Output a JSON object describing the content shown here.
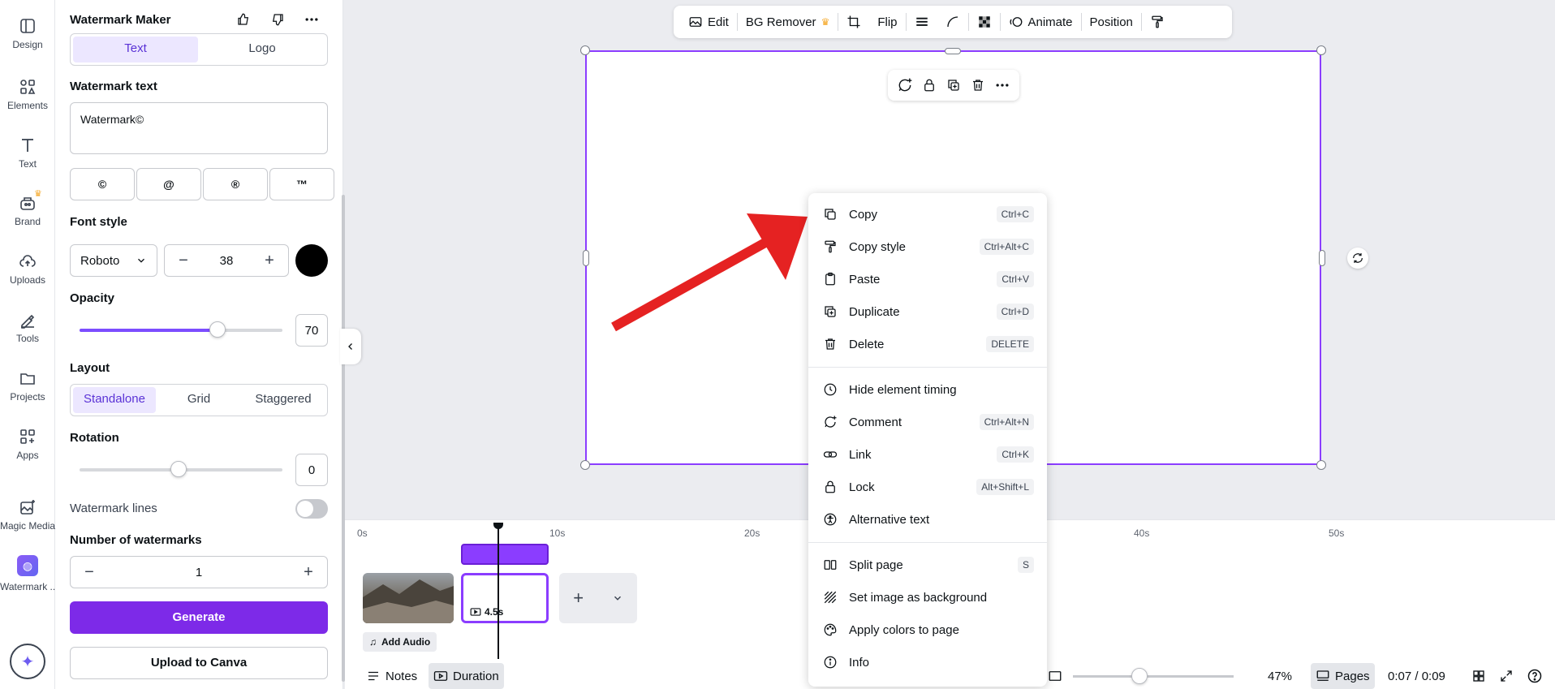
{
  "rail": {
    "items": [
      {
        "label": "Design",
        "icon": "design-icon"
      },
      {
        "label": "Elements",
        "icon": "elements-icon"
      },
      {
        "label": "Text",
        "icon": "text-icon"
      },
      {
        "label": "Brand",
        "icon": "brand-icon"
      },
      {
        "label": "Uploads",
        "icon": "uploads-icon"
      },
      {
        "label": "Tools",
        "icon": "tools-icon"
      },
      {
        "label": "Projects",
        "icon": "projects-icon"
      },
      {
        "label": "Apps",
        "icon": "apps-icon"
      },
      {
        "label": "Magic Media",
        "icon": "magic-media-icon"
      },
      {
        "label": "Watermark ...",
        "icon": "watermark-app-icon"
      }
    ]
  },
  "panel": {
    "title": "Watermark Maker",
    "tabs": [
      {
        "label": "Text",
        "active": true
      },
      {
        "label": "Logo",
        "active": false
      }
    ],
    "watermark_text_label": "Watermark text",
    "watermark_text_value": "Watermark©",
    "symbols": [
      "©",
      "@",
      "®",
      "™"
    ],
    "font_style_label": "Font style",
    "font_family": "Roboto",
    "font_size": "38",
    "font_color": "#000000",
    "opacity_label": "Opacity",
    "opacity_value": "70",
    "layout_label": "Layout",
    "layout_options": [
      {
        "label": "Standalone",
        "active": true
      },
      {
        "label": "Grid",
        "active": false
      },
      {
        "label": "Staggered",
        "active": false
      }
    ],
    "rotation_label": "Rotation",
    "rotation_value": "0",
    "watermark_lines_label": "Watermark lines",
    "number_label": "Number of watermarks",
    "number_value": "1",
    "generate_label": "Generate",
    "upload_label": "Upload to Canva"
  },
  "toolbar": {
    "edit": "Edit",
    "bg_remover": "BG Remover",
    "flip": "Flip",
    "animate": "Animate",
    "position": "Position"
  },
  "timeline": {
    "ticks": [
      "0s",
      "10s",
      "20s",
      "40s",
      "50s"
    ],
    "clip_duration": "4.5s",
    "add_audio": "Add Audio"
  },
  "bottom_bar": {
    "notes": "Notes",
    "duration": "Duration",
    "zoom": "47%",
    "pages": "Pages",
    "time": "0:07 / 0:09"
  },
  "context_menu": {
    "items": [
      {
        "label": "Copy",
        "shortcut": "Ctrl+C",
        "icon": "copy-icon"
      },
      {
        "label": "Copy style",
        "shortcut": "Ctrl+Alt+C",
        "icon": "paint-roller-icon"
      },
      {
        "label": "Paste",
        "shortcut": "Ctrl+V",
        "icon": "clipboard-icon"
      },
      {
        "label": "Duplicate",
        "shortcut": "Ctrl+D",
        "icon": "duplicate-icon"
      },
      {
        "label": "Delete",
        "shortcut": "DELETE",
        "icon": "trash-icon"
      },
      {
        "label": "Hide element timing",
        "shortcut": "",
        "icon": "clock-icon"
      },
      {
        "label": "Comment",
        "shortcut": "Ctrl+Alt+N",
        "icon": "comment-icon"
      },
      {
        "label": "Link",
        "shortcut": "Ctrl+K",
        "icon": "link-icon"
      },
      {
        "label": "Lock",
        "shortcut": "Alt+Shift+L",
        "icon": "lock-icon"
      },
      {
        "label": "Alternative text",
        "shortcut": "",
        "icon": "accessibility-icon"
      },
      {
        "label": "Split page",
        "shortcut": "S",
        "icon": "split-page-icon"
      },
      {
        "label": "Set image as background",
        "shortcut": "",
        "icon": "background-icon"
      },
      {
        "label": "Apply colors to page",
        "shortcut": "",
        "icon": "palette-icon"
      },
      {
        "label": "Info",
        "shortcut": "",
        "icon": "info-icon"
      }
    ]
  },
  "colors": {
    "accent": "#8b3dff",
    "primary_button": "#7d2ae8",
    "arrow": "#e52222"
  }
}
